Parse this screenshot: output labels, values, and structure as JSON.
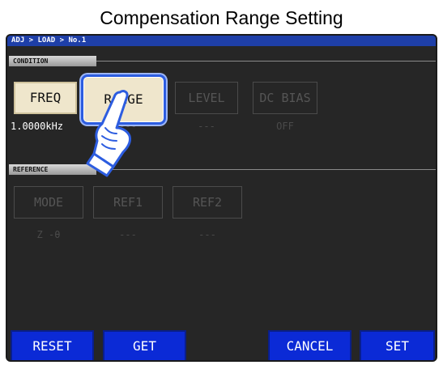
{
  "title": "Compensation Range Setting",
  "breadcrumb": "ADJ > LOAD > No.1",
  "condition": {
    "label": "CONDITION",
    "buttons": [
      {
        "label": "FREQ",
        "value": "1.0000kHz"
      },
      {
        "label": "RANGE",
        "value": "---"
      },
      {
        "label": "LEVEL",
        "value": "---"
      },
      {
        "label": "DC BIAS",
        "value": "OFF"
      }
    ]
  },
  "reference": {
    "label": "REFERENCE",
    "buttons": [
      {
        "label": "MODE",
        "value": "Z -θ"
      },
      {
        "label": "REF1",
        "value": "---"
      },
      {
        "label": "REF2",
        "value": "---"
      }
    ]
  },
  "footer": {
    "reset": "RESET",
    "get": "GET",
    "cancel": "CANCEL",
    "set": "SET"
  },
  "icons": {
    "pointer": "pointing-hand-icon"
  },
  "colors": {
    "screen_bg": "#262626",
    "breadcrumb_bg": "#1e3fa8",
    "button_active_bg": "#efe6cc",
    "highlight_border": "#2d5de0",
    "footer_button_bg": "#0b2ad6"
  }
}
